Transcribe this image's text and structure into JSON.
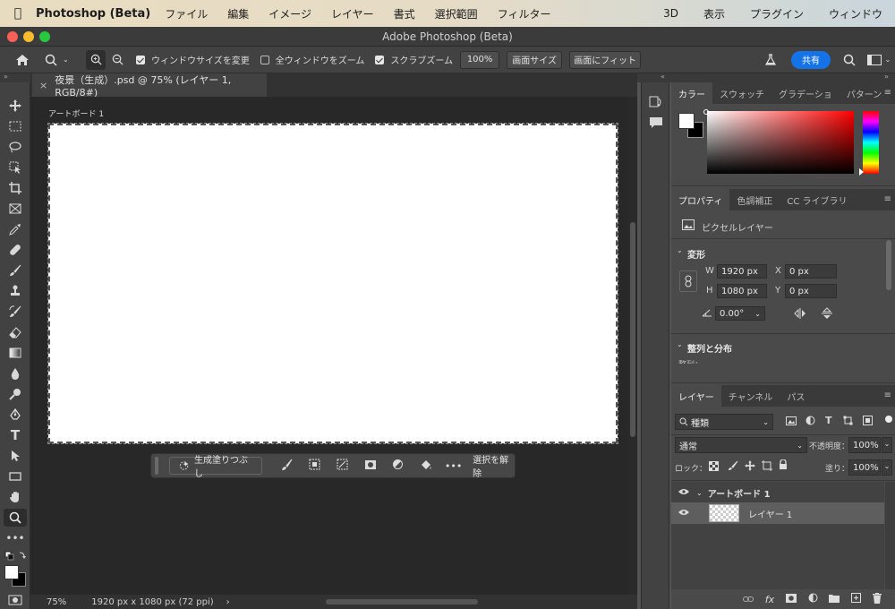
{
  "menubar": {
    "app_name": "Photoshop (Beta)",
    "items": [
      "ファイル",
      "編集",
      "イメージ",
      "レイヤー",
      "書式",
      "選択範囲",
      "フィルター"
    ],
    "right_items": [
      "3D",
      "表示",
      "プラグイン",
      "ウィンドウ"
    ]
  },
  "window": {
    "title": "Adobe Photoshop (Beta)"
  },
  "options": {
    "resize_windows": "ウィンドウサイズを変更",
    "zoom_all": "全ウィンドウをズーム",
    "scrubby_zoom": "スクラブズーム",
    "zoom_level": "100%",
    "fill_screen": "画面サイズ",
    "fit_screen": "画面にフィット",
    "share": "共有",
    "resize_checked": true,
    "zoom_all_checked": false,
    "scrubby_checked": true
  },
  "document": {
    "tab_title": "夜景（生成）.psd @ 75% (レイヤー 1, RGB/8#)",
    "artboard_name": "アートボード 1"
  },
  "taskbar": {
    "generative_fill": "生成塗りつぶし",
    "deselect": "選択を解除"
  },
  "status": {
    "zoom": "75%",
    "dims": "1920 px x 1080 px (72 ppi)"
  },
  "color_panel": {
    "tabs": [
      "カラー",
      "スウォッチ",
      "グラデーショ",
      "パターン"
    ]
  },
  "properties": {
    "tabs": [
      "プロパティ",
      "色調補正",
      "CC ライブラリ"
    ],
    "layer_type": "ピクセルレイヤー",
    "transform_title": "変形",
    "w_label": "W",
    "w_value": "1920 px",
    "h_label": "H",
    "h_value": "1080 px",
    "x_label": "X",
    "x_value": "0 px",
    "y_label": "Y",
    "y_value": "0 px",
    "angle": "0.00°",
    "align_title": "整列と分布",
    "align_sub": "整列："
  },
  "layers_panel": {
    "tabs": [
      "レイヤー",
      "チャンネル",
      "パス"
    ],
    "filter": "種類",
    "blend_mode": "通常",
    "opacity_label": "不透明度：",
    "opacity": "100%",
    "lock_label": "ロック：",
    "fill_label": "塗り：",
    "fill": "100%",
    "layers": [
      {
        "name": "アートボード 1",
        "type": "group"
      },
      {
        "name": "レイヤー 1",
        "type": "pixel"
      }
    ]
  },
  "colors": {
    "accent": "#1473e6",
    "panel_bg": "#4a4a4a",
    "canvas_bg": "#282828",
    "hue_base": "#ff0000"
  }
}
